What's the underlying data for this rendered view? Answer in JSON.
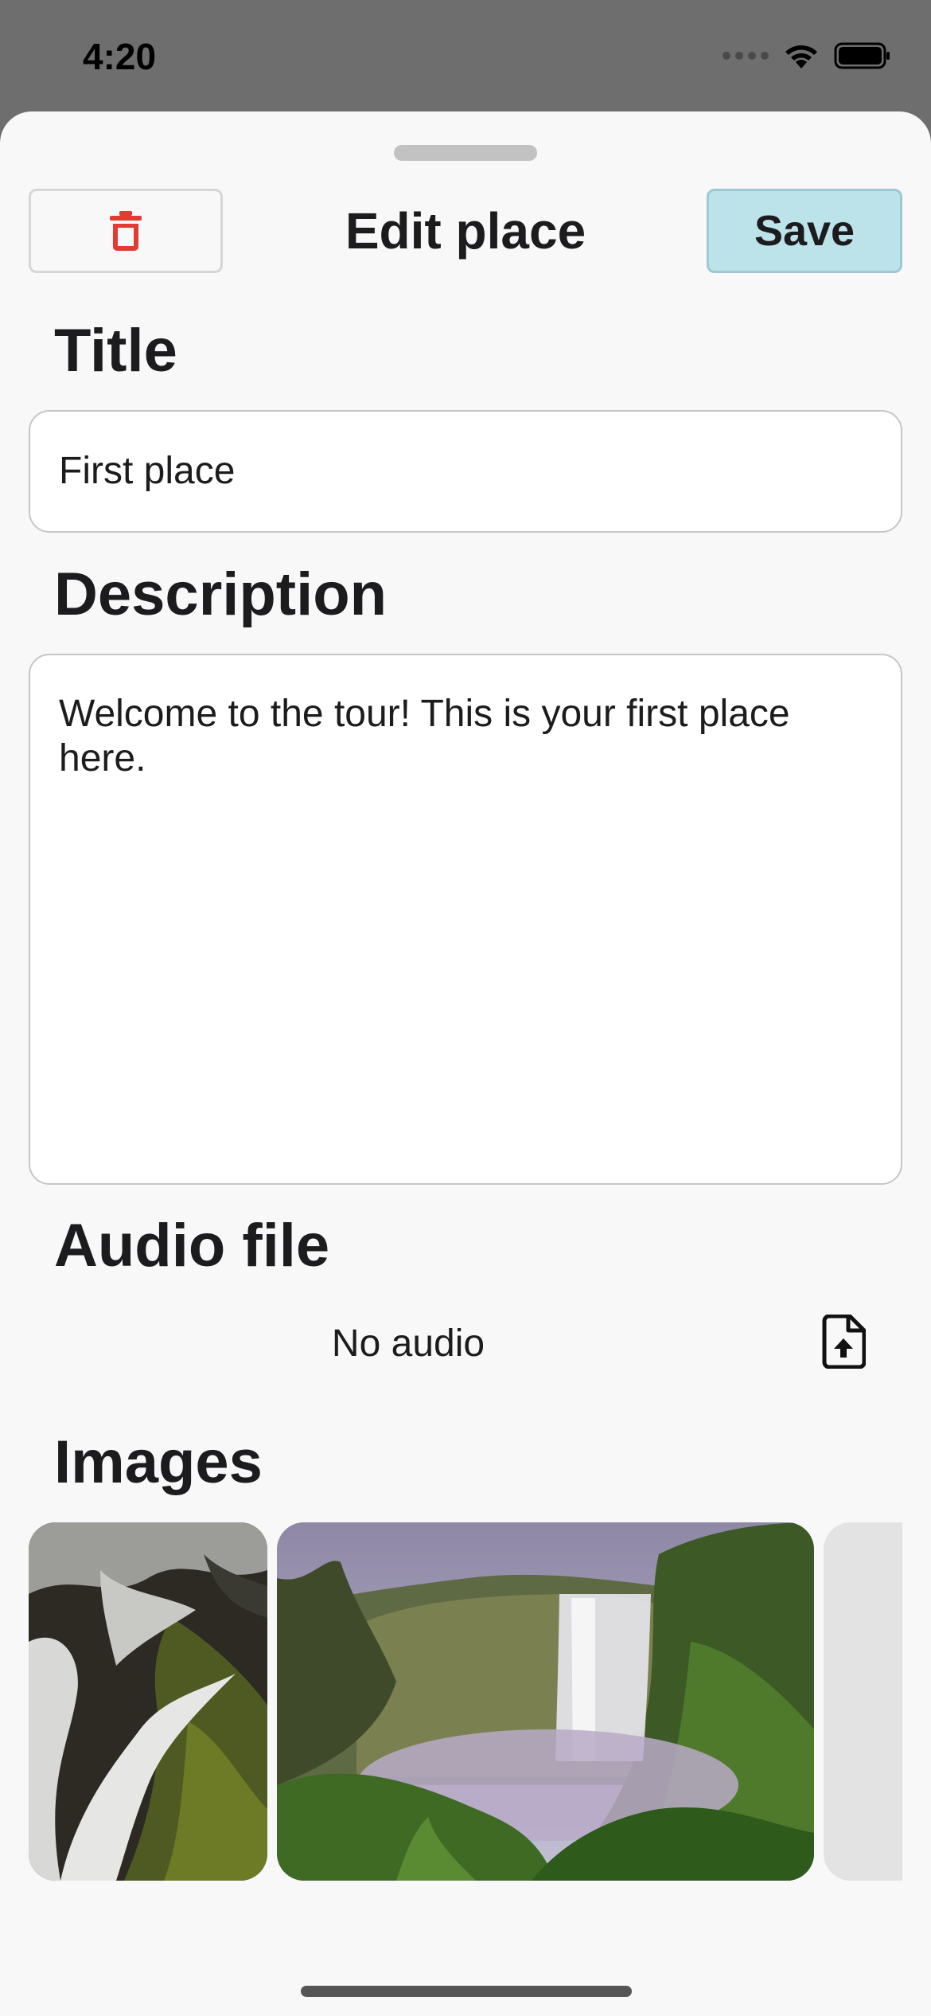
{
  "status_bar": {
    "time": "4:20"
  },
  "header": {
    "title": "Edit place",
    "save_label": "Save"
  },
  "fields": {
    "title_label": "Title",
    "title_value": "First place",
    "description_label": "Description",
    "description_value": "Welcome to the tour! This is your first place here."
  },
  "audio": {
    "label": "Audio file",
    "status": "No audio"
  },
  "images": {
    "label": "Images"
  },
  "colors": {
    "sheet_background": "#f8f8f8",
    "save_button_background": "#bde3ea",
    "delete_icon": "#e23b32",
    "field_border": "#c6c6c6"
  },
  "icons": [
    "trash-icon",
    "file-upload-icon",
    "wifi-icon",
    "battery-icon",
    "signal-icon"
  ]
}
